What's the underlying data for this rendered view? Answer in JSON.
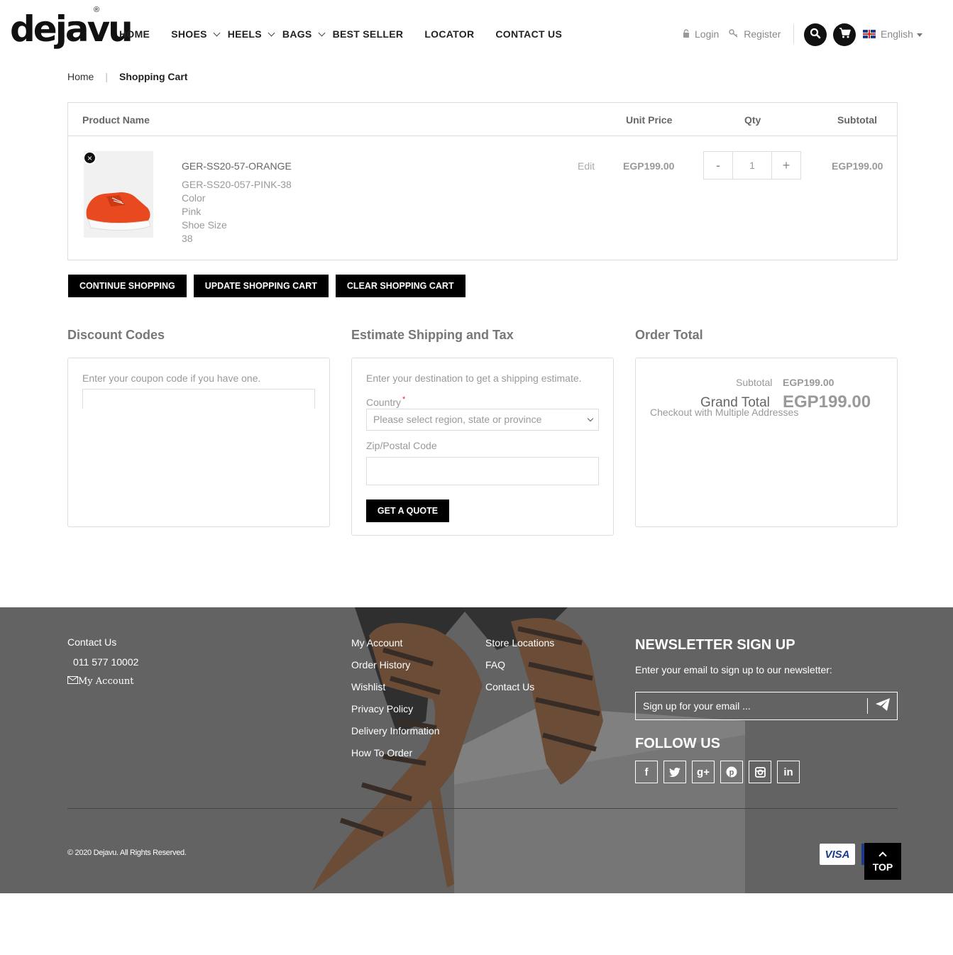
{
  "brand": {
    "logo_text": "dejavu",
    "logo_mark": "®"
  },
  "nav": {
    "home": "HOME",
    "shoes": "SHOES",
    "heels": "HEELS",
    "bags": "BAGS",
    "best_seller": "BEST SELLER",
    "locator": "LOCATOR",
    "contact_us": "CONTACT US"
  },
  "account": {
    "login": "Login",
    "register": "Register",
    "language": "English"
  },
  "icons": {
    "lock": "lock-icon",
    "key": "key-icon",
    "search": "search-icon",
    "cart": "cart-icon",
    "flag": "uk-flag-icon",
    "remove": "close-icon",
    "send": "paper-plane-icon",
    "envelope": "envelope-icon",
    "top": "chevron-up-icon"
  },
  "breadcrumb": {
    "home": "Home",
    "separator": "|",
    "current": "Shopping Cart"
  },
  "cart": {
    "headers": {
      "product": "Product Name",
      "unit_price": "Unit Price",
      "qty": "Qty",
      "subtotal": "Subtotal"
    },
    "item": {
      "name": "GER-SS20-57-ORANGE",
      "sku": "GER-SS20-057-PINK-38",
      "color_label": "Color",
      "color_value": "Pink",
      "size_label": "Shoe Size",
      "size_value": "38",
      "edit": "Edit",
      "unit_price": "EGP199.00",
      "qty_minus": "-",
      "qty": "1",
      "qty_plus": "+",
      "subtotal": "EGP199.00",
      "remove": "×"
    }
  },
  "actions": {
    "continue": "CONTINUE SHOPPING",
    "update": "UPDATE SHOPPING CART",
    "clear": "CLEAR SHOPPING CART"
  },
  "discount": {
    "title": "Discount Codes",
    "hint": "Enter your coupon code if you have one."
  },
  "shipping": {
    "title": "Estimate Shipping and Tax",
    "hint": "Enter your destination to get a shipping estimate.",
    "country_label": "Country",
    "required_mark": "*",
    "region_placeholder": "Please select region, state or province",
    "zip_label": "Zip/Postal Code",
    "quote_button": "GET A QUOTE"
  },
  "order_total": {
    "title": "Order Total",
    "subtotal_label": "Subtotal",
    "subtotal_value": "EGP199.00",
    "grand_label": "Grand Total",
    "grand_value": "EGP199.00",
    "multi_checkout": "Checkout with Multiple Addresses"
  },
  "footer": {
    "contact_title": "Contact Us",
    "phone": "011 577 10002",
    "my_account_contact": "My Account",
    "links_col1": [
      "My Account",
      "Order History",
      "Wishlist",
      "Privacy Policy",
      "Delivery Information",
      "How To Order"
    ],
    "links_col2": [
      "Store Locations",
      "FAQ",
      "Contact Us"
    ],
    "newsletter_title": "NEWSLETTER SIGN UP",
    "newsletter_text": "Enter your email to sign up to our newsletter:",
    "newsletter_placeholder": "Sign up for your email ...",
    "follow_title": "FOLLOW US",
    "social": [
      "f",
      "t",
      "g+",
      "p",
      "ig",
      "in"
    ],
    "copyright": "© 2020 Dejavu. All Rights Reserved.",
    "visa": "VISA",
    "top": "TOP"
  },
  "colors": {
    "accent": "#000000",
    "footer_bg": "#6f6e6e",
    "product": "#e8491e"
  }
}
